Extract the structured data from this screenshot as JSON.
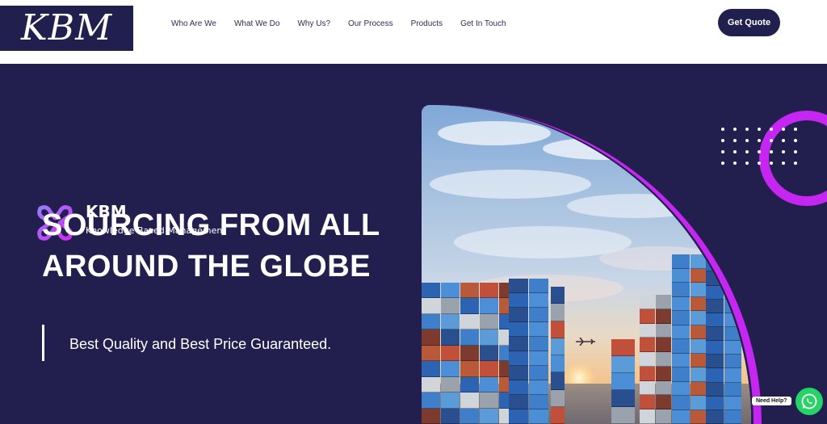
{
  "header": {
    "logo_text": "KBM",
    "nav": [
      {
        "label": "Who Are We"
      },
      {
        "label": "What We Do"
      },
      {
        "label": "Why Us?"
      },
      {
        "label": "Our Process"
      },
      {
        "label": "Products"
      },
      {
        "label": "Get In Touch"
      }
    ],
    "cta_label": "Get Quote"
  },
  "hero": {
    "brand_name": "KBM",
    "brand_subtitle": "Knowledge Based Management",
    "headline_line1": "SOURCING FROM ALL",
    "headline_line2": "AROUND THE GLOBE",
    "tagline": "Best Quality and Best Price Guaranteed."
  },
  "help_widget": {
    "label": "Need Help?",
    "icon": "whatsapp-icon"
  },
  "colors": {
    "brand_navy": "#211f4d",
    "accent_purple": "#c526f2",
    "whatsapp_green": "#25d366"
  }
}
